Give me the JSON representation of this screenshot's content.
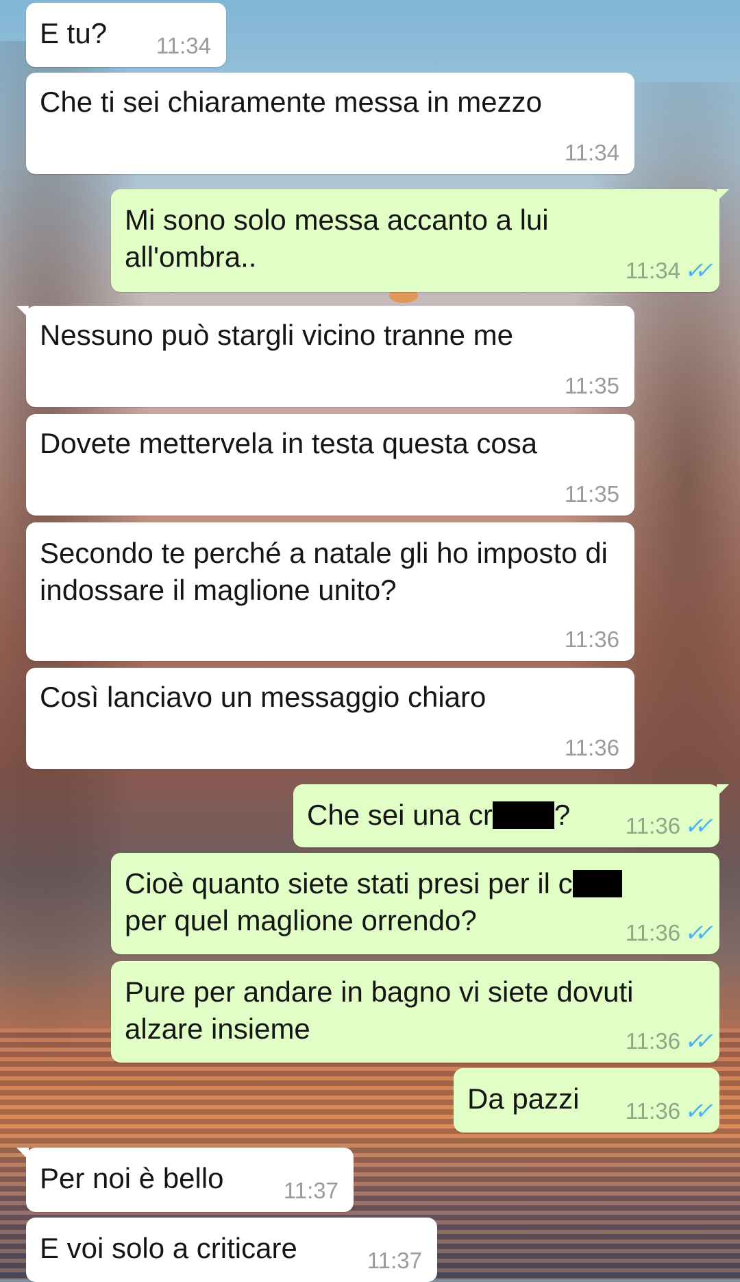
{
  "messages": [
    {
      "dir": "in",
      "text": "E tu?",
      "time": "11:34"
    },
    {
      "dir": "in",
      "text": "Che ti sei chiaramente messa in mezzo",
      "time": "11:34"
    },
    {
      "dir": "out",
      "text": "Mi sono solo messa accanto a lui all'ombra..",
      "time": "11:34"
    },
    {
      "dir": "in",
      "text": "Nessuno può stargli vicino tranne me",
      "time": "11:35"
    },
    {
      "dir": "in",
      "text": "Dovete mettervela in testa questa cosa",
      "time": "11:35"
    },
    {
      "dir": "in",
      "text": "Secondo te perché a natale gli ho imposto di indossare il maglione unito?",
      "time": "11:36"
    },
    {
      "dir": "in",
      "text": "Così lanciavo un messaggio chiaro",
      "time": "11:36"
    },
    {
      "dir": "out",
      "text_before": "Che sei una cr",
      "text_after": "?",
      "time": "11:36",
      "redacted": true
    },
    {
      "dir": "out",
      "text_line1": "Cioè quanto siete stati presi per il c",
      "text_line2": "per quel maglione orrendo?",
      "time": "11:36",
      "redacted": true
    },
    {
      "dir": "out",
      "text": "Pure per andare in bagno vi siete dovuti alzare insieme",
      "time": "11:36"
    },
    {
      "dir": "out",
      "text": "Da pazzi",
      "time": "11:36"
    },
    {
      "dir": "in",
      "text": "Per noi è bello",
      "time": "11:37"
    },
    {
      "dir": "in",
      "text": "E voi solo a criticare",
      "time": "11:37"
    }
  ],
  "read_receipt_icon": "double-check-icon",
  "colors": {
    "incoming_bubble": "#ffffff",
    "outgoing_bubble": "#e1fec6",
    "read_ticks": "#4fb3f0",
    "timestamp": "#9a9a9a"
  }
}
